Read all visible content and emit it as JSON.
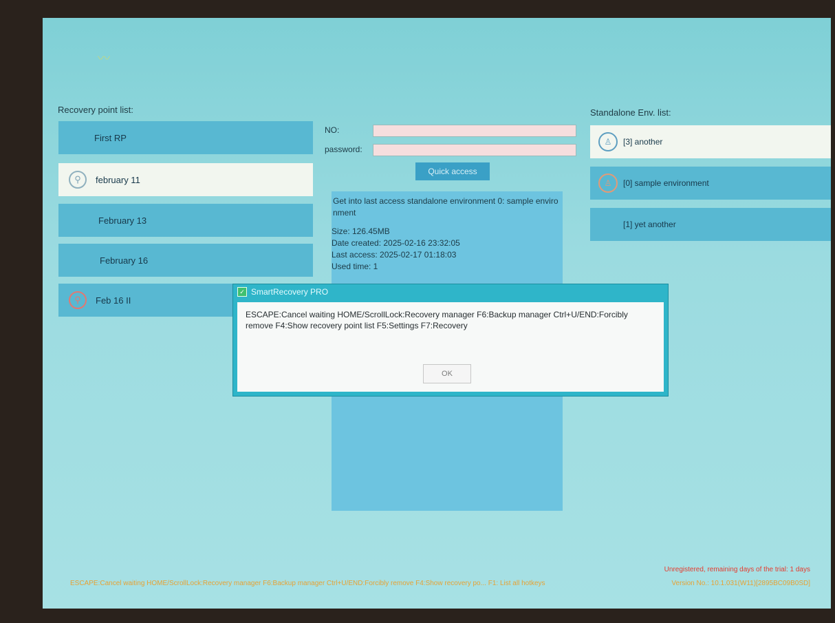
{
  "recovery": {
    "title": "Recovery point list:",
    "items": [
      {
        "label": "First RP"
      },
      {
        "label": "february 11"
      },
      {
        "label": "February 13"
      },
      {
        "label": "February 16"
      },
      {
        "label": "Feb 16 II"
      }
    ]
  },
  "login": {
    "no_label": "NO:",
    "password_label": "password:",
    "quick_access": "Quick access"
  },
  "info": {
    "description": "Get into last access standalone environment 0: sample environment",
    "size": "Size: 126.45MB",
    "date_created": "Date created: 2025-02-16 23:32:05",
    "last_access": "Last access: 2025-02-17 01:18:03",
    "used_time": "Used time: 1"
  },
  "env": {
    "title": "Standalone Env. list:",
    "items": [
      {
        "label": "[3] another"
      },
      {
        "label": "[0] sample environment"
      },
      {
        "label": "[1] yet another"
      }
    ]
  },
  "dialog": {
    "title": "SmartRecovery PRO",
    "message": "ESCAPE:Cancel waiting HOME/ScrollLock:Recovery manager F6:Backup manager Ctrl+U/END:Forcibly remove F4:Show recovery point list F5:Settings F7:Recovery",
    "ok": "OK"
  },
  "footer": {
    "hotkeys": "ESCAPE:Cancel waiting HOME/ScrollLock:Recovery manager F6:Backup manager Ctrl+U/END:Forcibly remove F4:Show recovery po... F1: List all hotkeys",
    "trial": "Unregistered, remaining days of the trial: 1 days",
    "version": "Version No.: 10.1.031(W11)[2895BC09B0SD]"
  },
  "colors": {
    "accent": "#58b8d2",
    "selected": "#f2f6ef",
    "dialog_frame": "#2fb5c9",
    "footer_text": "#e6a235",
    "trial_text": "#e53b2f"
  }
}
